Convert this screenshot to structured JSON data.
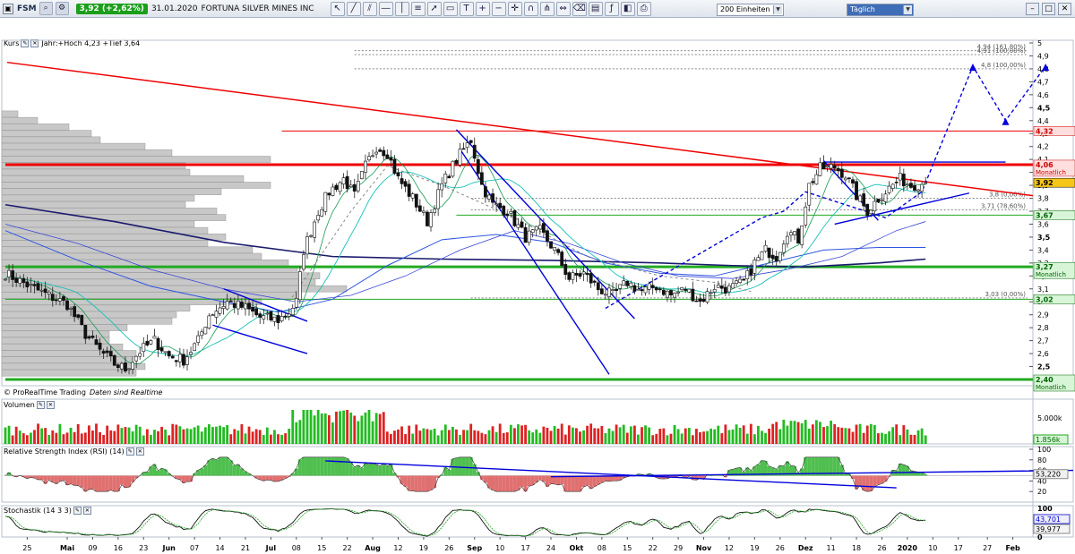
{
  "toolbar": {
    "symbol": "FSM",
    "price_badge": "3,92 (+2,62%)",
    "date": "31.01.2020",
    "name": "FORTUNA SILVER MINES INC",
    "units": "200 Einheiten",
    "interval": "Täglich"
  },
  "panes": {
    "price": {
      "title": "Kurs",
      "info": "Jahr:+Hoch 4,23 +Tief 3,64",
      "source": "© ProRealTime Trading",
      "source_note": "Daten sind Realtime"
    },
    "volume": {
      "title": "Volumen"
    },
    "rsi": {
      "title": "Relative Strength Index (RSI) (14)"
    },
    "stoch": {
      "title": "Stochastik (14 3 3)"
    }
  },
  "colors": {
    "up": "#1faa1f",
    "down": "#111111",
    "resistance": "#ee0000",
    "support": "#22aa22",
    "channel": "#0000dd",
    "ma_long": "#1a1a6e",
    "ma_mid": "#2e55e0",
    "ma_short": "#18c0b8",
    "vol_up": "#22bb22",
    "vol_down": "#dd2222",
    "rsi_fill_up": "#4fbf4f",
    "rsi_fill_down": "#e07070"
  },
  "chart_data": [
    {
      "type": "candlestick",
      "ylim": [
        2.3,
        5.0
      ],
      "yticks": [
        "5",
        "4,9",
        "4,8",
        "4,7",
        "4,6",
        "4,5",
        "4,4",
        "4,3",
        "4,2",
        "4,1",
        "4",
        "3,9",
        "3,8",
        "3,7",
        "3,6",
        "3,5",
        "3,4",
        "3,3",
        "3,2",
        "3,1",
        "3",
        "2,9",
        "2,8",
        "2,7",
        "2,6",
        "2,5",
        "2,4"
      ],
      "ytick_values": [
        5.0,
        4.9,
        4.8,
        4.7,
        4.6,
        4.5,
        4.4,
        4.3,
        4.2,
        4.1,
        4.0,
        3.9,
        3.8,
        3.7,
        3.6,
        3.5,
        3.4,
        3.3,
        3.2,
        3.1,
        3.0,
        2.9,
        2.8,
        2.7,
        2.6,
        2.5,
        2.4
      ],
      "bold_ticks": [
        "4,5",
        "4",
        "3,5",
        "2,5"
      ],
      "xticks": [
        "25",
        "Mai",
        "09",
        "16",
        "23",
        "Jun",
        "07",
        "14",
        "21",
        "Jul",
        "08",
        "15",
        "22",
        "Aug",
        "12",
        "19",
        "26",
        "Sep",
        "10",
        "17",
        "24",
        "Okt",
        "08",
        "15",
        "22",
        "29",
        "Nov",
        "12",
        "19",
        "26",
        "Dez",
        "11",
        "18",
        "26",
        "2020",
        "10",
        "17",
        "27",
        "Feb",
        "10",
        "18",
        "25",
        "Mär"
      ],
      "xtick_index": [
        6,
        17,
        24,
        31,
        38,
        45,
        52,
        59,
        66,
        73,
        80,
        87,
        94,
        101,
        108,
        115,
        122,
        129,
        136,
        143,
        150,
        157,
        164,
        171,
        178,
        185,
        192,
        199,
        206,
        213,
        220,
        227,
        234,
        241,
        248,
        255,
        262,
        270,
        277,
        284,
        291,
        298,
        305
      ],
      "bold_xticks": [
        "Mai",
        "Jun",
        "Jul",
        "Aug",
        "Sep",
        "Okt",
        "Nov",
        "Dez",
        "2020",
        "Feb",
        "Mär"
      ],
      "anchors": [
        [
          0,
          3.22
        ],
        [
          8,
          3.1
        ],
        [
          17,
          2.98
        ],
        [
          22,
          2.75
        ],
        [
          26,
          2.62
        ],
        [
          30,
          2.52
        ],
        [
          33,
          2.48
        ],
        [
          37,
          2.62
        ],
        [
          41,
          2.7
        ],
        [
          45,
          2.58
        ],
        [
          49,
          2.55
        ],
        [
          53,
          2.7
        ],
        [
          56,
          2.9
        ],
        [
          61,
          3.0
        ],
        [
          66,
          2.95
        ],
        [
          70,
          2.88
        ],
        [
          75,
          2.86
        ],
        [
          78,
          2.92
        ],
        [
          80,
          3.0
        ],
        [
          82,
          3.4
        ],
        [
          86,
          3.7
        ],
        [
          89,
          3.85
        ],
        [
          93,
          3.95
        ],
        [
          96,
          3.82
        ],
        [
          99,
          4.05
        ],
        [
          102,
          4.2
        ],
        [
          105,
          4.15
        ],
        [
          108,
          3.95
        ],
        [
          112,
          3.8
        ],
        [
          116,
          3.62
        ],
        [
          120,
          3.9
        ],
        [
          124,
          4.1
        ],
        [
          128,
          4.25
        ],
        [
          131,
          3.9
        ],
        [
          134,
          3.75
        ],
        [
          138,
          3.7
        ],
        [
          143,
          3.5
        ],
        [
          147,
          3.55
        ],
        [
          151,
          3.4
        ],
        [
          155,
          3.18
        ],
        [
          159,
          3.22
        ],
        [
          163,
          3.1
        ],
        [
          167,
          3.05
        ],
        [
          171,
          3.15
        ],
        [
          175,
          3.08
        ],
        [
          179,
          3.12
        ],
        [
          183,
          3.05
        ],
        [
          187,
          3.1
        ],
        [
          191,
          3.0
        ],
        [
          195,
          3.12
        ],
        [
          199,
          3.1
        ],
        [
          203,
          3.15
        ],
        [
          206,
          3.3
        ],
        [
          209,
          3.4
        ],
        [
          212,
          3.35
        ],
        [
          215,
          3.55
        ],
        [
          218,
          3.48
        ],
        [
          221,
          3.9
        ],
        [
          224,
          4.03
        ],
        [
          228,
          4.04
        ],
        [
          231,
          3.98
        ],
        [
          234,
          3.82
        ],
        [
          237,
          3.7
        ],
        [
          240,
          3.8
        ],
        [
          243,
          3.88
        ],
        [
          246,
          3.95
        ],
        [
          249,
          3.9
        ],
        [
          253,
          3.92
        ]
      ],
      "ma_long": [
        [
          0,
          3.75
        ],
        [
          30,
          3.62
        ],
        [
          60,
          3.46
        ],
        [
          90,
          3.35
        ],
        [
          120,
          3.33
        ],
        [
          150,
          3.32
        ],
        [
          180,
          3.3
        ],
        [
          200,
          3.28
        ],
        [
          220,
          3.27
        ],
        [
          240,
          3.3
        ],
        [
          253,
          3.33
        ]
      ],
      "ma_mid": [
        [
          0,
          3.55
        ],
        [
          20,
          3.32
        ],
        [
          40,
          3.12
        ],
        [
          60,
          3.0
        ],
        [
          75,
          2.92
        ],
        [
          90,
          3.02
        ],
        [
          105,
          3.28
        ],
        [
          120,
          3.48
        ],
        [
          135,
          3.52
        ],
        [
          150,
          3.46
        ],
        [
          165,
          3.3
        ],
        [
          180,
          3.22
        ],
        [
          195,
          3.2
        ],
        [
          210,
          3.3
        ],
        [
          225,
          3.4
        ],
        [
          240,
          3.42
        ],
        [
          253,
          3.42
        ]
      ],
      "ma_mid2": [
        [
          0,
          3.6
        ],
        [
          20,
          3.45
        ],
        [
          40,
          3.25
        ],
        [
          60,
          3.1
        ],
        [
          80,
          3.0
        ],
        [
          95,
          3.05
        ],
        [
          110,
          3.2
        ],
        [
          125,
          3.4
        ],
        [
          140,
          3.55
        ],
        [
          155,
          3.45
        ],
        [
          170,
          3.3
        ],
        [
          185,
          3.2
        ],
        [
          200,
          3.18
        ],
        [
          215,
          3.25
        ],
        [
          230,
          3.35
        ],
        [
          245,
          3.55
        ],
        [
          253,
          3.62
        ]
      ],
      "horizontal_lines": [
        {
          "value": 4.32,
          "color": "#ee0000",
          "width": 1,
          "from": 76
        },
        {
          "value": 4.06,
          "color": "#ee0000",
          "width": 3,
          "from": 0
        },
        {
          "value": 3.67,
          "color": "#22aa22",
          "width": 1,
          "from": 124
        },
        {
          "value": 3.27,
          "color": "#22aa22",
          "width": 3,
          "from": 0
        },
        {
          "value": 3.02,
          "color": "#22aa22",
          "width": 1,
          "from": 0
        },
        {
          "value": 2.4,
          "color": "#22aa22",
          "width": 3,
          "from": 0
        }
      ],
      "fib_lines": [
        {
          "value": 4.94,
          "label": "4,94 (161,80%)"
        },
        {
          "value": 4.91,
          "label": "4,91 (100,00%)"
        },
        {
          "value": 4.8,
          "label": "4,8 (100,00%)"
        },
        {
          "value": 3.8,
          "label": "3,8 (0,00%)"
        },
        {
          "value": 3.71,
          "label": "3,71 (78,60%)"
        },
        {
          "value": 3.03,
          "label": "3,03 (0,00%)"
        }
      ],
      "price_labels": [
        {
          "value": 4.32,
          "text": "4,32",
          "bg": "#ffdede",
          "color": "#cc0000"
        },
        {
          "value": 4.06,
          "text": "4,06",
          "text2": "Monatlich",
          "bg": "#ffdede",
          "color": "#cc0000"
        },
        {
          "value": 3.92,
          "text": "3,92",
          "bg": "#f5c518",
          "color": "#000"
        },
        {
          "value": 3.67,
          "text": "3,67",
          "bg": "#d8f5d8",
          "color": "#006600"
        },
        {
          "value": 3.27,
          "text": "3,27",
          "text2": "Monatlich",
          "bg": "#d8f5d8",
          "color": "#006600"
        },
        {
          "value": 3.02,
          "text": "3,02",
          "bg": "#d8f5d8",
          "color": "#006600"
        },
        {
          "value": 2.4,
          "text": "2,40",
          "text2": "Monatlich",
          "bg": "#d8f5d8",
          "color": "#006600"
        }
      ]
    },
    {
      "type": "bar",
      "name": "Volumen",
      "yticks": [
        "5.000k"
      ],
      "last_label": "1.856k"
    },
    {
      "type": "area",
      "name": "RSI",
      "yticks": [
        "100",
        "80",
        "60",
        "40",
        "20"
      ],
      "ytick_values": [
        100,
        80,
        60,
        40,
        20
      ],
      "last_label": "53,220"
    },
    {
      "type": "line",
      "name": "Stochastik",
      "yticks": [
        "100",
        "0"
      ],
      "ytick_values": [
        100,
        0
      ],
      "last_labels": [
        "43,701",
        "39,977"
      ]
    }
  ]
}
